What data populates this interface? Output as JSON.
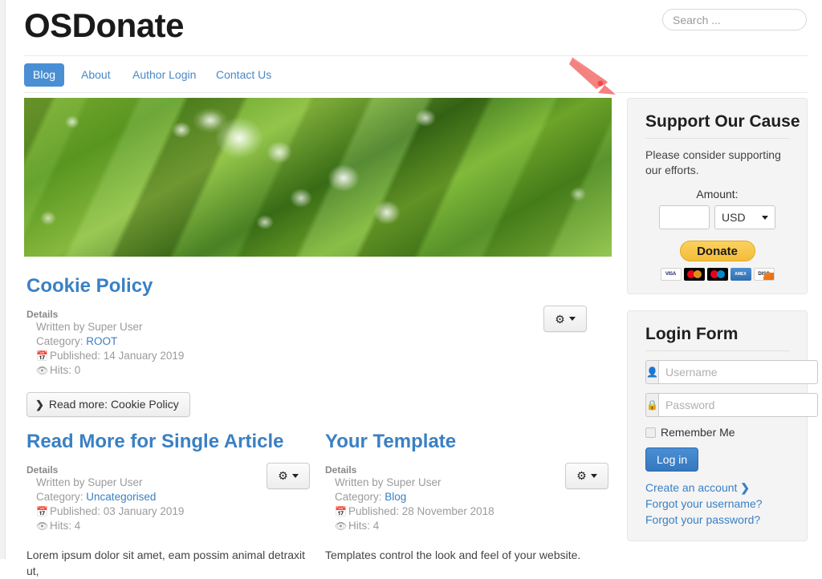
{
  "site": {
    "title": "OSDonate"
  },
  "search": {
    "placeholder": "Search ...",
    "value": ""
  },
  "nav": {
    "items": [
      {
        "label": "Blog",
        "active": true
      },
      {
        "label": "About",
        "active": false
      },
      {
        "label": "Author Login",
        "active": false
      },
      {
        "label": "Contact Us",
        "active": false
      }
    ]
  },
  "hero": {
    "alt": "Close-up photo of green grass blades covered in water droplets"
  },
  "articles": [
    {
      "title": "Cookie Policy",
      "details_label": "Details",
      "written_by": "Written by Super User",
      "category_label": "Category:",
      "category": "ROOT",
      "published": "Published: 14 January 2019",
      "hits": "Hits: 0",
      "read_more": "Read more: Cookie Policy",
      "body": ""
    },
    {
      "title": "Read More for Single Article",
      "details_label": "Details",
      "written_by": "Written by Super User",
      "category_label": "Category:",
      "category": "Uncategorised",
      "published": "Published: 03 January 2019",
      "hits": "Hits: 4",
      "read_more": "",
      "body": "Lorem ipsum dolor sit amet, eam possim animal detraxit ut,"
    },
    {
      "title": "Your Template",
      "details_label": "Details",
      "written_by": "Written by Super User",
      "category_label": "Category:",
      "category": "Blog",
      "published": "Published: 28 November 2018",
      "hits": "Hits: 4",
      "read_more": "",
      "body": "Templates control the look and feel of your website."
    }
  ],
  "sidebar": {
    "donate": {
      "title": "Support Our Cause",
      "description": "Please consider supporting our efforts.",
      "amount_label": "Amount:",
      "amount_value": "",
      "currency": "USD",
      "currency_options": [
        "USD"
      ],
      "donate_label": "Donate",
      "cards": [
        "VISA",
        "MasterCard",
        "Maestro",
        "American Express",
        "Discover"
      ]
    },
    "login": {
      "title": "Login Form",
      "username_placeholder": "Username",
      "username_value": "",
      "password_placeholder": "Password",
      "password_value": "",
      "remember_label": "Remember Me",
      "login_label": "Log in",
      "links": [
        "Create an account",
        "Forgot your username?",
        "Forgot your password?"
      ]
    }
  },
  "icons": {
    "gear": "⚙",
    "calendar": "Ὄ5",
    "eye": "ὄ1",
    "chevron_right": "❯",
    "user": "὆4",
    "lock": "ὑ2"
  },
  "colors": {
    "accent_blue": "#3a80c4",
    "nav_active": "#4a8fd4",
    "donate_gold": "#f3bd3a",
    "panel_bg": "#f4f4f4",
    "arrow": "#f4827f"
  }
}
